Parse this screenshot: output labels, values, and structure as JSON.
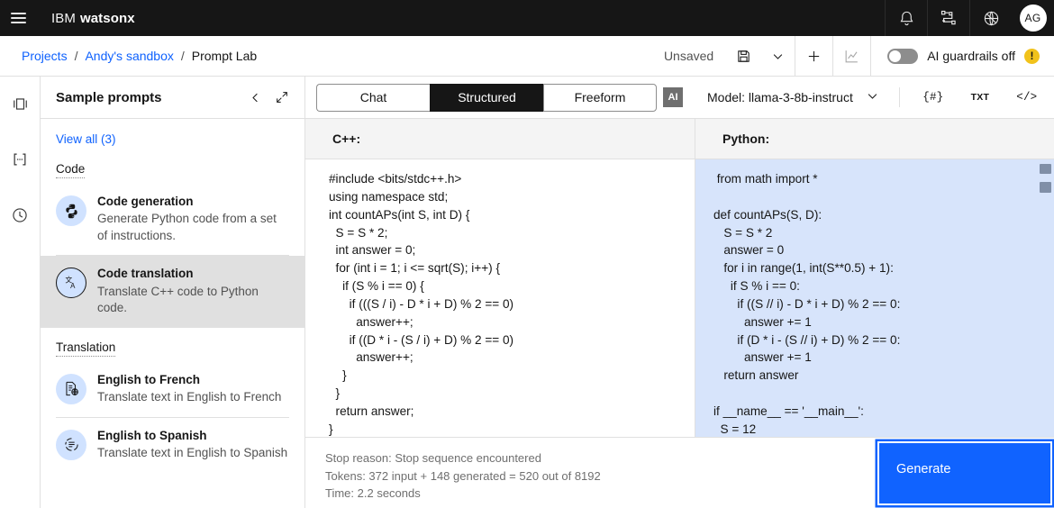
{
  "header": {
    "menu_icon": "hamburger-menu-icon",
    "brand_prefix": "IBM",
    "brand_name": "watsonx",
    "icons": [
      {
        "name": "notifications-icon",
        "label": "Notifications"
      },
      {
        "name": "workflow-icon",
        "label": "Workflows"
      },
      {
        "name": "globe-icon",
        "label": "Region"
      }
    ],
    "avatar_initials": "AG"
  },
  "breadcrumb": {
    "items": [
      {
        "label": "Projects",
        "link": true
      },
      {
        "label": "Andy's sandbox",
        "link": true
      },
      {
        "label": "Prompt Lab",
        "link": false
      }
    ],
    "separator": "/"
  },
  "toolbar": {
    "save_state": "Unsaved",
    "save_icon": "save-icon",
    "caret_icon": "chevron-down-icon",
    "new_icon": "plus-icon",
    "chart_icon": "chart-icon",
    "guardrails_label": "AI guardrails off",
    "guardrails_on": false,
    "warning_icon": "warning-icon",
    "warning_glyph": "!"
  },
  "rail": {
    "items": [
      {
        "name": "toggle-panel-icon",
        "label": "Toggle side panel"
      },
      {
        "name": "variables-icon",
        "label": "[...]"
      },
      {
        "name": "history-clock-icon",
        "label": "History"
      }
    ]
  },
  "sidebar": {
    "title": "Sample prompts",
    "collapse_icon": "chevron-left-icon",
    "expand_icon": "expand-icon",
    "view_all": "View all (3)",
    "groups": [
      {
        "label": "Code",
        "items": [
          {
            "title": "Code generation",
            "desc": "Generate Python code from a set of instructions.",
            "icon": "python-logo-icon",
            "selected": false
          },
          {
            "title": "Code translation",
            "desc": "Translate C++ code to Python code.",
            "icon": "translate-icon",
            "selected": true
          }
        ]
      },
      {
        "label": "Translation",
        "items": [
          {
            "title": "English to French",
            "desc": "Translate text in English to French",
            "icon": "document-globe-icon",
            "selected": false
          },
          {
            "title": "English to Spanish",
            "desc": "Translate text in English to Spanish",
            "icon": "text-lines-icon",
            "selected": false
          }
        ]
      }
    ]
  },
  "modes": {
    "tabs": [
      {
        "label": "Chat",
        "active": false
      },
      {
        "label": "Structured",
        "active": true
      },
      {
        "label": "Freeform",
        "active": false
      }
    ],
    "ai_badge": "AI"
  },
  "model": {
    "label": "Model: llama-3-8b-instruct",
    "caret_icon": "chevron-down-icon",
    "actions": [
      {
        "name": "parameters-icon",
        "label": "{#}"
      },
      {
        "name": "text-format-icon",
        "label": "TXT"
      },
      {
        "name": "code-view-icon",
        "label": "</>"
      }
    ]
  },
  "editors": {
    "left": {
      "title": "C++:",
      "code": "#include <bits/stdc++.h>\nusing namespace std;\nint countAPs(int S, int D) {\n  S = S * 2;\n  int answer = 0;\n  for (int i = 1; i <= sqrt(S); i++) {\n    if (S % i == 0) {\n      if (((S / i) - D * i + D) % 2 == 0)\n        answer++;\n      if ((D * i - (S / i) + D) % 2 == 0)\n        answer++;\n    }\n  }\n  return answer;\n}"
    },
    "right": {
      "title": "Python:",
      "code": " from math import *\n\ndef countAPs(S, D):\n   S = S * 2\n   answer = 0\n   for i in range(1, int(S**0.5) + 1):\n     if S % i == 0:\n       if ((S // i) - D * i + D) % 2 == 0:\n         answer += 1\n       if (D * i - (S // i) + D) % 2 == 0:\n         answer += 1\n   return answer\n\nif __name__ == '__main__':\n  S = 12"
    }
  },
  "status": {
    "stop_reason": "Stop reason: Stop sequence encountered",
    "tokens": "Tokens: 372 input + 148 generated = 520 out of 8192",
    "time": "Time: 2.2 seconds"
  },
  "generate": {
    "label": "Generate"
  },
  "colors": {
    "accent": "#0f62fe",
    "generate_blue": "#1063ff",
    "header_black": "#161616",
    "python_panel": "#d7e4fb",
    "warning_yellow": "#f1c21b",
    "icon_circle": "#d0e2ff"
  }
}
